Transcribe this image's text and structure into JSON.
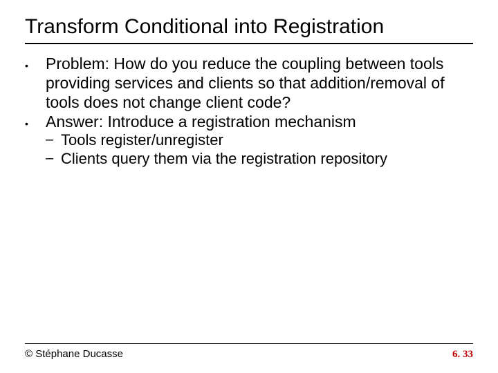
{
  "title": "Transform Conditional into Registration",
  "bullets": {
    "problem": "Problem: How do you reduce the coupling between tools providing services and clients so that addition/removal of tools does not change client code?",
    "answer": "Answer: Introduce a registration mechanism",
    "sub1": "Tools register/unregister",
    "sub2": "Clients query them via the registration repository"
  },
  "footer": {
    "author": "© Stéphane Ducasse",
    "page": "6. 33"
  }
}
